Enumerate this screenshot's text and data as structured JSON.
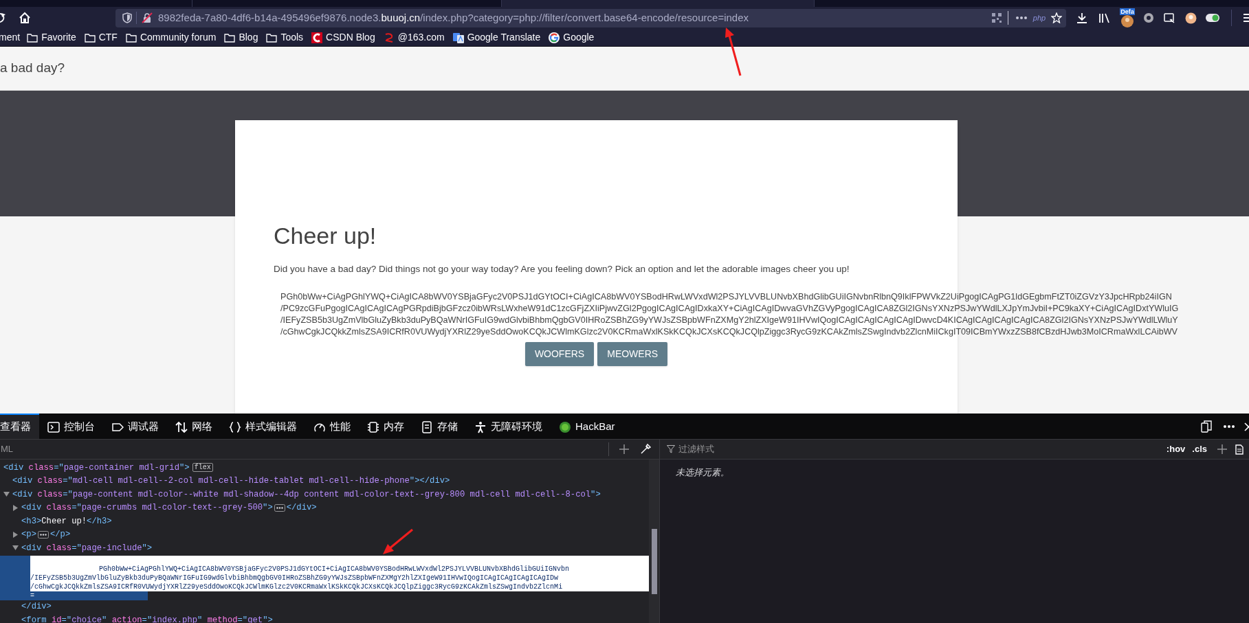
{
  "browser": {
    "tabs": [
      {
        "selected": false
      },
      {
        "selected": false
      },
      {
        "selected": true
      }
    ],
    "url": {
      "subdomain": "8982feda-7a80-4df6-b14a-495496ef9876.node3.",
      "domain": "buuoj.cn",
      "path": "/index.php?category=php://filter/convert.base64-encode/resource=index"
    },
    "url_badge": "php",
    "extension_badge": "Defa",
    "bookmarks": [
      {
        "label": "ment",
        "kind": "text"
      },
      {
        "label": "Favorite",
        "kind": "folder"
      },
      {
        "label": "CTF",
        "kind": "folder"
      },
      {
        "label": "Community forum",
        "kind": "folder"
      },
      {
        "label": "Blog",
        "kind": "folder"
      },
      {
        "label": "Tools",
        "kind": "folder"
      },
      {
        "label": "CSDN Blog",
        "kind": "csdn"
      },
      {
        "label": "@163.com",
        "kind": "mail"
      },
      {
        "label": "Google Translate",
        "kind": "translate"
      },
      {
        "label": "Google",
        "kind": "google"
      }
    ]
  },
  "page": {
    "header_text": "a bad day?",
    "card": {
      "title": "Cheer up!",
      "paragraph": "Did you have a bad day? Did things not go your way today? Are you feeling down? Pick an option and let the adorable images cheer you up!",
      "encoded_lines": [
        "PGh0bWw+CiAgPGhlYWQ+CiAgICA8bWV0YSBjaGFyc2V0PSJ1dGYtOCI+CiAgICA8bWV0YSBodHRwLWVxdWl2PSJYLVVBLUNvbXBhdGlibGUiIGNvbnRlbnQ9IklFPWVkZ2UiPgogICAgPG1ldGEgbmFtZT0iZGVzY3JpcHRpb24iIGN",
        "/PC9zcGFuPgogICAgICAgICAgPGRpdiBjbGFzcz0ibWRsLWxheW91dC1zcGFjZXIiPjwvZGl2PgogICAgICAgIDxkaXY+CiAgICAgIDwvaGVhZGVyPgogICAgICA8ZGl2IGNsYXNzPSJwYWdlLXJpYmJvbiI+PC9kaXY+CiAgICAgIDxtYWluIG",
        "/IEFyZSB5b3UgZmVlbGluZyBkb3duPyBQaWNrIGFuIG9wdGlvbiBhbmQgbGV0IHRoZSBhZG9yYWJsZSBpbWFnZXMgY2hlZXIgeW91IHVwIQogICAgICAgICAgICAgIDwvcD4KICAgICAgICAgICAgICA8ZGl2IGNsYXNzPSJwYWdlLWluY",
        "/cGhwCgkJCQkkZmlsZSA9ICRfR0VUWydjYXRlZ29yeSddOwoKCQkJCWlmKGlzc2V0KCRmaWxlKSkKCQkJCXsKCQkJCQlpZiggc3RycG9zKCAkZmlsZSwgIndvb2ZlcnMiICkgIT09ICBmYWxzZSB8fCBzdHJwb3MoICRmaWxlLCAibWV"
      ],
      "buttons": [
        "WOOFERS",
        "MEOWERS"
      ]
    }
  },
  "devtools": {
    "tabs": [
      {
        "label": "查看器",
        "kind": "inspector",
        "selected": true
      },
      {
        "label": "控制台",
        "kind": "console",
        "selected": false
      },
      {
        "label": "调试器",
        "kind": "debugger",
        "selected": false
      },
      {
        "label": "网络",
        "kind": "network",
        "selected": false
      },
      {
        "label": "样式编辑器",
        "kind": "style",
        "selected": false
      },
      {
        "label": "性能",
        "kind": "performance",
        "selected": false
      },
      {
        "label": "内存",
        "kind": "memory",
        "selected": false
      },
      {
        "label": "存储",
        "kind": "storage",
        "selected": false
      },
      {
        "label": "无障碍环境",
        "kind": "accessibility",
        "selected": false
      },
      {
        "label": "HackBar",
        "kind": "hackbar",
        "selected": false
      }
    ],
    "markup_search": {
      "placeholder": "ML"
    },
    "tree": [
      {
        "line": [
          {
            "kind": "tag",
            "text": "<div"
          },
          {
            "kind": "attr",
            "text": "class"
          },
          {
            "kind": "tag",
            "text": "=\""
          },
          {
            "kind": "value",
            "text": "page-container mdl-grid"
          },
          {
            "kind": "tag",
            "text": "\">"
          }
        ],
        "badge": "flex",
        "children": [
          {
            "line": [
              {
                "kind": "tag",
                "text": "<div"
              },
              {
                "kind": "attr",
                "text": "class"
              },
              {
                "kind": "tag",
                "text": "=\""
              },
              {
                "kind": "value",
                "text": "mdl-cell mdl-cell--2-col mdl-cell--hide-tablet mdl-cell--hide-phone"
              },
              {
                "kind": "tag",
                "text": "\"></div>"
              }
            ]
          },
          {
            "line": [
              {
                "kind": "tag",
                "text": "<div"
              },
              {
                "kind": "attr",
                "text": "class"
              },
              {
                "kind": "tag",
                "text": "=\""
              },
              {
                "kind": "value",
                "text": "page-content mdl-color--white mdl-shadow--4dp content mdl-color-text--grey-800 mdl-cell mdl-cell--8-col"
              },
              {
                "kind": "tag",
                "text": "\">"
              }
            ],
            "expanded": true,
            "children": [
              {
                "line": [
                  {
                    "kind": "tag",
                    "text": "<div"
                  },
                  {
                    "kind": "attr",
                    "text": "class"
                  },
                  {
                    "kind": "tag",
                    "text": "=\""
                  },
                  {
                    "kind": "value",
                    "text": "page-crumbs mdl-color-text--grey-500"
                  },
                  {
                    "kind": "tag",
                    "text": "\">"
                  },
                  {
                    "kind": "collapsed"
                  },
                  {
                    "kind": "tag",
                    "text": "</div>"
                  }
                ],
                "expanded": false
              },
              {
                "line": [
                  {
                    "kind": "tag",
                    "text": "<h3>"
                  },
                  {
                    "kind": "text",
                    "text": "Cheer up!"
                  },
                  {
                    "kind": "tag",
                    "text": "</h3>"
                  }
                ]
              },
              {
                "line": [
                  {
                    "kind": "tag",
                    "text": "<p>"
                  },
                  {
                    "kind": "collapsed"
                  },
                  {
                    "kind": "tag",
                    "text": "</p>"
                  }
                ],
                "expanded": false
              },
              {
                "line": [
                  {
                    "kind": "tag",
                    "text": "<div"
                  },
                  {
                    "kind": "attr",
                    "text": "class"
                  },
                  {
                    "kind": "tag",
                    "text": "=\""
                  },
                  {
                    "kind": "value",
                    "text": "page-include"
                  },
                  {
                    "kind": "tag",
                    "text": "\">"
                  }
                ],
                "expanded": true,
                "closing_line": [
                  {
                    "kind": "tag",
                    "text": "</div>"
                  }
                ],
                "children": [
                  {
                    "kind": "text",
                    "selected": true,
                    "lines": [
                      "PGh0bWw+CiAgPGhlYWQ+CiAgICA8bWV0YSBjaGFyc2V0PSJ1dGYtOCI+CiAgICA8bWV0YSBodHRwLWVxdWl2PSJYLVVBLUNvbXBhdGlibGUiIGNvbn",
                      "/IEFyZSB5b3UgZmVlbGluZyBkb3duPyBQaWNrIGFuIG9wdGlvbiBhbmQgbGV0IHRoZSBhZG9yYWJsZSBpbWFnZXMgY2hlZXIgeW91IHVwIQogICAgICAgICAgICAgIDw",
                      "/cGhwCgkJCQkkZmlsZSA9ICRfR0VUWydjYXRlZ29yeSddOwoKCQkJCWlmKGlzc2V0KCRmaWxlKSkKCQkJCXsKCQkJCQlpZiggc3RycG9zKCAkZmlsZSwgIndvb2ZlcnMi",
                      "="
                    ]
                  }
                ]
              },
              {
                "line": [
                  {
                    "kind": "tag",
                    "text": "<form"
                  },
                  {
                    "kind": "attr",
                    "text": "id"
                  },
                  {
                    "kind": "tag",
                    "text": "=\""
                  },
                  {
                    "kind": "value",
                    "text": "choice"
                  },
                  {
                    "kind": "tag",
                    "text": "\""
                  },
                  {
                    "kind": "attr",
                    "text": "action"
                  },
                  {
                    "kind": "tag",
                    "text": "=\""
                  },
                  {
                    "kind": "value",
                    "text": "index.php"
                  },
                  {
                    "kind": "tag",
                    "text": "\""
                  },
                  {
                    "kind": "attr",
                    "text": "method"
                  },
                  {
                    "kind": "tag",
                    "text": "=\""
                  },
                  {
                    "kind": "value",
                    "text": "get"
                  },
                  {
                    "kind": "tag",
                    "text": "\">"
                  }
                ]
              }
            ]
          }
        ]
      }
    ],
    "rules_filter": {
      "placeholder": "过滤样式"
    },
    "rule_buttons": [
      ":hov",
      ".cls"
    ],
    "empty_message": "未选择元素。"
  }
}
